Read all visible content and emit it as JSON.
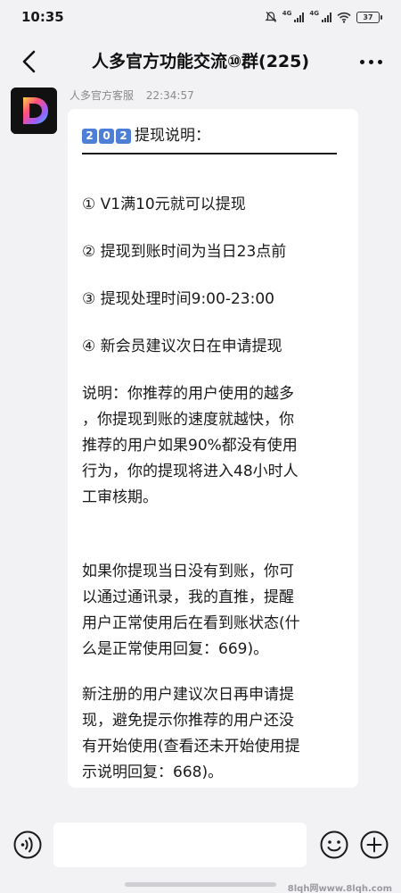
{
  "status_bar": {
    "time": "10:35",
    "network_1": "4G",
    "network_2": "4G",
    "battery": "37"
  },
  "header": {
    "title": "人多官方功能交流⑩群(225)"
  },
  "message": {
    "sender_name": "人多官方客服",
    "timestamp": "22:34:57",
    "heading_keycaps": [
      "2",
      "0",
      "2"
    ],
    "heading_text": "提现说明：",
    "lines": [
      "① V1满10元就可以提现",
      "② 提现到账时间为当日23点前",
      "③ 提现处理时间9:00-23:00",
      "④ 新会员建议次日在申请提现",
      "说明：你推荐的用户使用的越多\n，你提现到账的速度就越快，你\n推荐的用户如果90%都没有使用\n行为，你的提现将进入48小时人\n工审核期。",
      "如果你提现当日没有到账，你可\n以通过通讯录，我的直推，提醒\n用户正常使用后在看到账状态(什\n么是正常使用回复：669)。",
      "新注册的用户建议次日再申请提\n现，避免提示你推荐的用户还没\n有开始使用(查看还未开始使用提\n示说明回复：668)。"
    ]
  },
  "watermark": "8lqh网www.8lqh.com",
  "colors": {
    "background": "#f2f2f4",
    "bubble": "#ffffff",
    "keycap": "#4d7fd6",
    "avatar_bg": "#111111"
  }
}
